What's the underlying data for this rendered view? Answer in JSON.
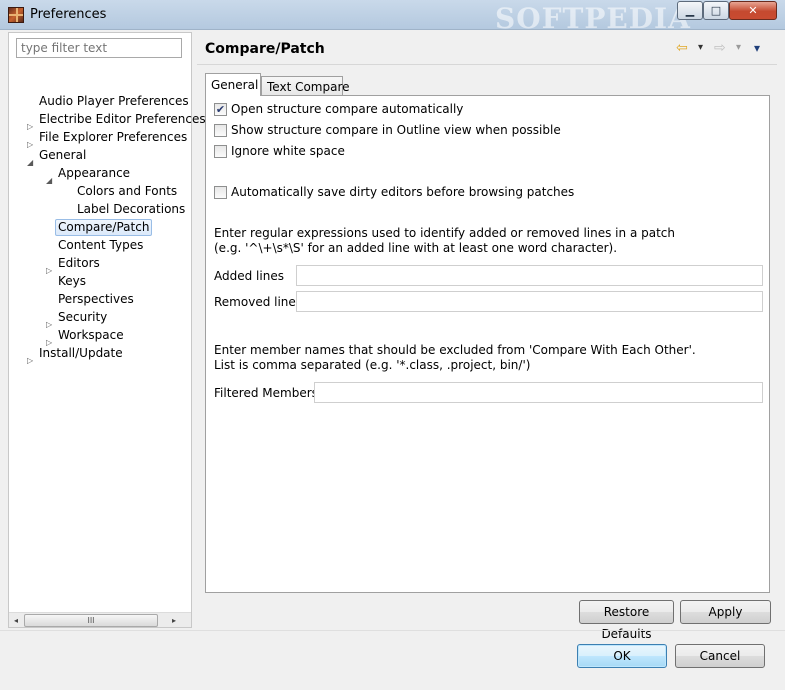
{
  "window": {
    "title": "Preferences",
    "watermark": "SOFTPEDIA"
  },
  "controls": {
    "minimize": "▁",
    "maximize": "□",
    "close": "✕"
  },
  "filter": {
    "placeholder": "type filter text"
  },
  "tree": [
    {
      "label": "Audio Player Preferences",
      "expandable": false
    },
    {
      "label": "Electribe Editor Preferences",
      "expandable": true,
      "expanded": false
    },
    {
      "label": "File Explorer Preferences",
      "expandable": true,
      "expanded": false
    },
    {
      "label": "General",
      "expandable": true,
      "expanded": true
    },
    {
      "label": "Appearance",
      "expandable": true,
      "expanded": true
    },
    {
      "label": "Colors and Fonts",
      "expandable": false
    },
    {
      "label": "Label Decorations",
      "expandable": false
    },
    {
      "label": "Compare/Patch",
      "expandable": false,
      "selected": true
    },
    {
      "label": "Content Types",
      "expandable": false
    },
    {
      "label": "Editors",
      "expandable": true,
      "expanded": false
    },
    {
      "label": "Keys",
      "expandable": false
    },
    {
      "label": "Perspectives",
      "expandable": false
    },
    {
      "label": "Security",
      "expandable": true,
      "expanded": false
    },
    {
      "label": "Workspace",
      "expandable": true,
      "expanded": false
    },
    {
      "label": "Install/Update",
      "expandable": true,
      "expanded": false
    }
  ],
  "scroll": {
    "left": "◂",
    "right": "▸",
    "grip": "III"
  },
  "page": {
    "title": "Compare/Patch"
  },
  "nav": {
    "back": "⇦",
    "forward": "⇨",
    "dropdown": "▾",
    "menu": "▾"
  },
  "tabs": [
    {
      "label": "General",
      "active": true
    },
    {
      "label": "Text Compare",
      "active": false
    }
  ],
  "general": {
    "checkboxes": [
      {
        "label": "Open structure compare automatically",
        "checked": true
      },
      {
        "label": "Show structure compare in Outline view when possible",
        "checked": false
      },
      {
        "label": "Ignore white space",
        "checked": false
      },
      {
        "label": "Automatically save dirty editors before browsing patches",
        "checked": false
      }
    ],
    "regex_info_1": "Enter regular expressions used to identify added or removed lines in a patch",
    "regex_info_2": "(e.g. '^\\+\\s*\\S' for an added line with at least one word character).",
    "added_lines_label": "Added lines",
    "added_lines_value": "",
    "removed_lines_label": "Removed lines",
    "removed_lines_value": "",
    "members_info_1": "Enter member names that should be excluded from 'Compare With Each Other'.",
    "members_info_2": "List is comma separated (e.g. '*.class, .project, bin/')",
    "filtered_members_label": "Filtered Members:",
    "filtered_members_value": ""
  },
  "buttons": {
    "restore_defaults": "Restore Defaults",
    "apply": "Apply",
    "ok": "OK",
    "cancel": "Cancel"
  }
}
